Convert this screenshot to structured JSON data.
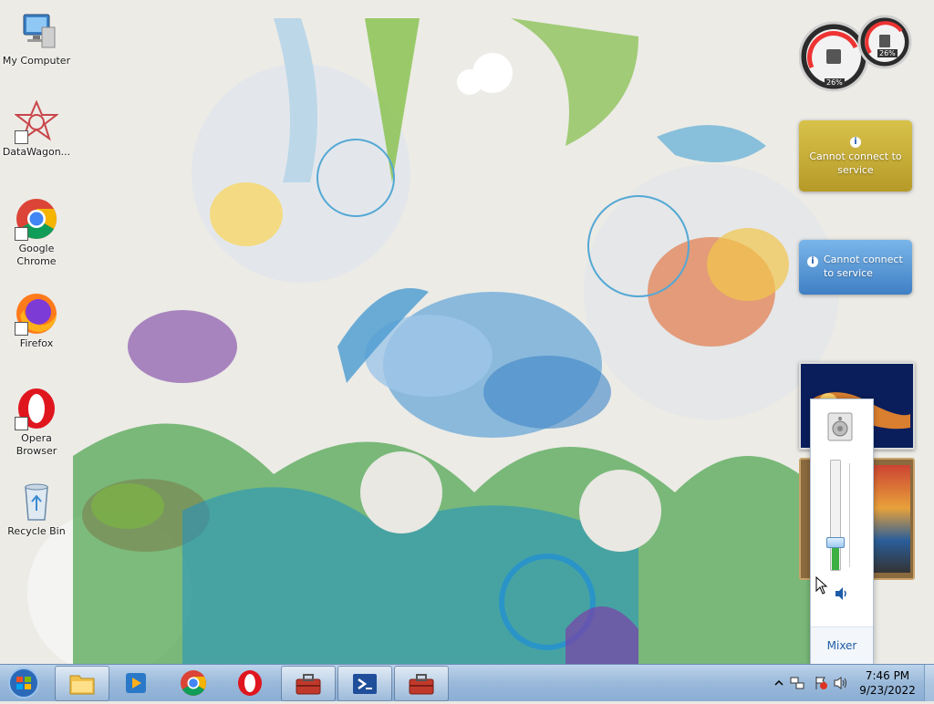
{
  "desktop": {
    "icons": [
      {
        "label": "My Computer",
        "icon": "computer-icon"
      },
      {
        "label": "DataWagon...",
        "icon": "datawagon-icon"
      },
      {
        "label": "Google Chrome",
        "icon": "chrome-icon"
      },
      {
        "label": "Firefox",
        "icon": "firefox-icon"
      },
      {
        "label": "Opera Browser",
        "icon": "opera-icon"
      },
      {
        "label": "Recycle Bin",
        "icon": "recycle-bin-icon"
      }
    ]
  },
  "gadgets": {
    "cpu_meter": {
      "cpu": "26%",
      "memory": "26%"
    },
    "weather_1": {
      "message": "Cannot connect to service",
      "color": "#c9b030"
    },
    "weather_2": {
      "message": "Cannot connect to service",
      "color": "#4f8fd0"
    }
  },
  "volume_flyout": {
    "mixer_label": "Mixer",
    "level": 0.25
  },
  "taskbar": {
    "apps": [
      "file-explorer-icon",
      "media-player-icon",
      "chrome-icon",
      "opera-icon",
      "toolbox-icon",
      "powershell-icon",
      "toolbox-icon"
    ],
    "clock": {
      "time": "7:46 PM",
      "date": "9/23/2022"
    }
  },
  "colors": {
    "taskbar": "#9ab9da",
    "accent": "#1e5ca8"
  }
}
